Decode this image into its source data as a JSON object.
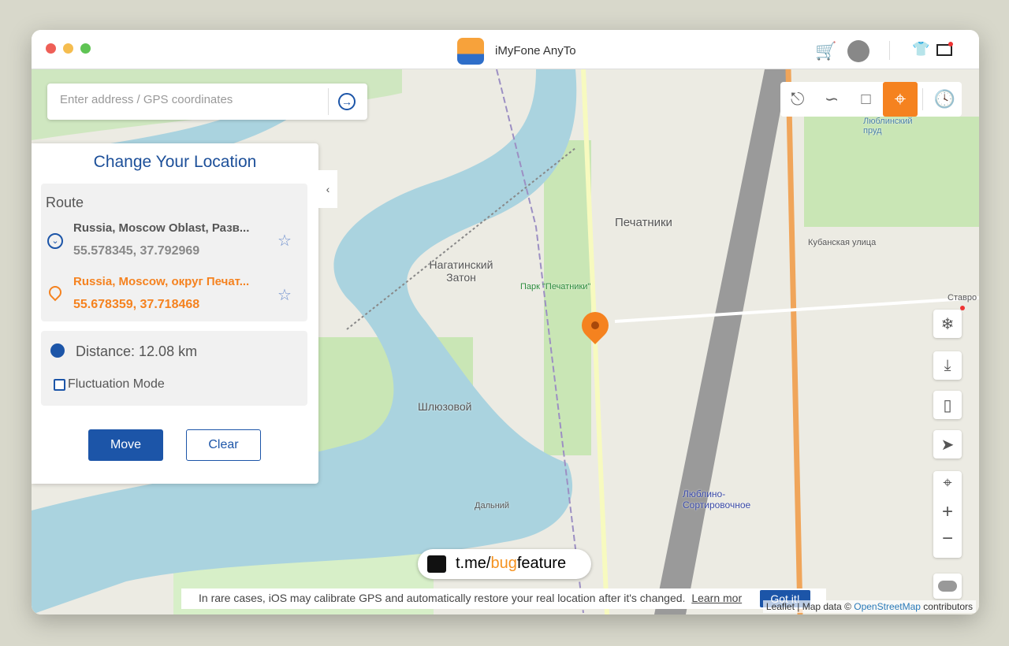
{
  "window": {
    "title": "iMyFone AnyTo"
  },
  "search": {
    "placeholder": "Enter address / GPS coordinates"
  },
  "panel": {
    "title": "Change Your Location",
    "route_label": "Route",
    "start": {
      "name": "Russia, Moscow Oblast, Разв...",
      "coords": "55.578345, 37.792969"
    },
    "end": {
      "name": "Russia, Moscow, округ Печат...",
      "coords": "55.678359, 37.718468"
    },
    "distance": "Distance: 12.08 km",
    "fluctuation_label": "Fluctuation Mode",
    "fluctuation_checked": false,
    "move_label": "Move",
    "clear_label": "Clear"
  },
  "map_labels": [
    "Нагатинский Затон",
    "Печатники",
    "Шлюзовой",
    "Дальний",
    "Люблино-Сортировочное",
    "Парк \"Печатники\"",
    "Кубанская улица",
    "Люблинский пруд",
    "Ставро"
  ],
  "watermark": {
    "prefix": "t.me/",
    "highlight": "bug",
    "suffix": "feature"
  },
  "notice": {
    "text": "In rare cases, iOS may calibrate GPS and automatically restore your real location after it's changed.",
    "link": "Learn mor",
    "button": "Got it!"
  },
  "attribution": {
    "prefix": "Leaflet | Map data © ",
    "link": "OpenStreetMap",
    "suffix": " contributors"
  },
  "colors": {
    "accent": "#f5821f",
    "primary": "#1c55a8"
  }
}
